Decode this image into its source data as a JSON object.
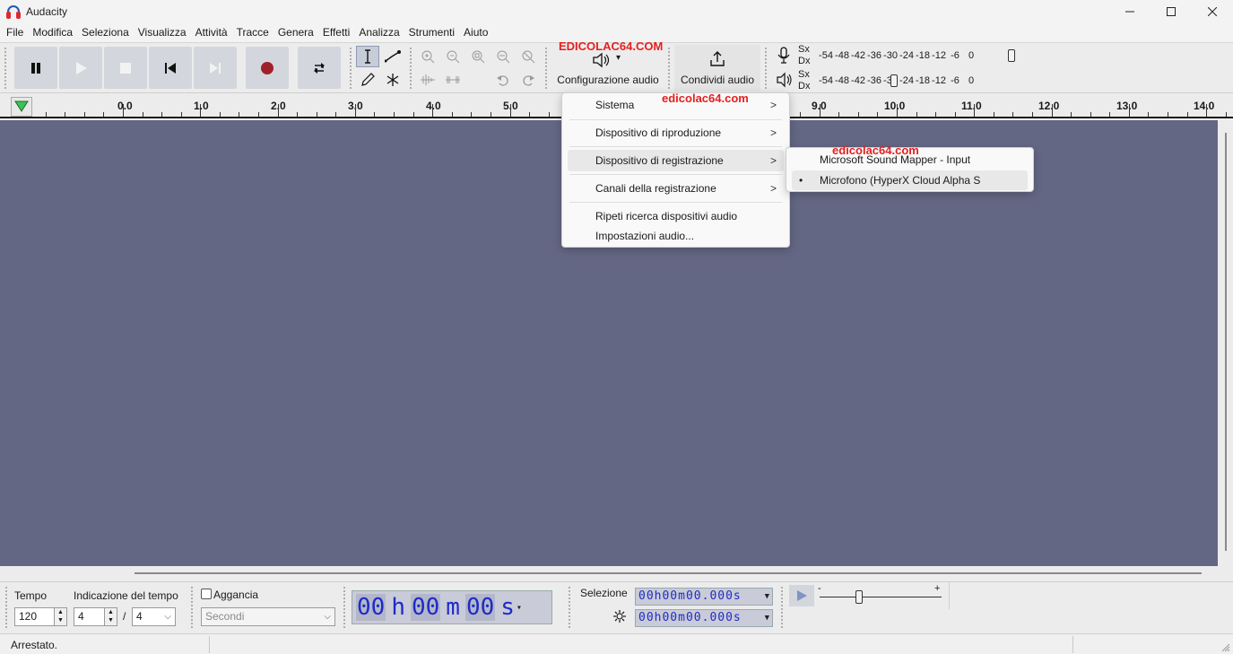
{
  "window": {
    "title": "Audacity",
    "minimize": "—",
    "maximize": "☐",
    "close": "✕"
  },
  "menubar": [
    "File",
    "Modifica",
    "Seleziona",
    "Visualizza",
    "Attività",
    "Tracce",
    "Genera",
    "Effetti",
    "Analizza",
    "Strumenti",
    "Aiuto"
  ],
  "toolbar": {
    "audio_setup_label": "Configurazione audio",
    "audio_setup_arrow": "▾",
    "share_audio_label": "Condividi audio",
    "watermark_top": "EDICOLAC64.COM",
    "meters": {
      "record_channels": [
        "Sx",
        "Dx"
      ],
      "play_channels": [
        "Sx",
        "Dx"
      ],
      "record_scale": [
        "-54",
        "-48",
        "-42",
        "-36",
        "-30",
        "-24",
        "-18",
        "-12",
        "-6",
        "0"
      ],
      "play_scale": [
        "-54",
        "-48",
        "-42",
        "-36",
        "-30",
        "-24",
        "-18",
        "-12",
        "-6",
        "0"
      ]
    }
  },
  "timeline": {
    "ticks": [
      "0.0",
      "1.0",
      "2.0",
      "3.0",
      "4.0",
      "5.0",
      "9.0",
      "10.0",
      "11.0",
      "12.0",
      "13.0",
      "14.0"
    ]
  },
  "audio_menu": {
    "watermark": "edicolac64.com",
    "items": [
      {
        "label": "Sistema",
        "submenu": true
      },
      {
        "label": "Dispositivo di riproduzione",
        "submenu": true
      },
      {
        "label": "Dispositivo di registrazione",
        "submenu": true
      },
      {
        "label": "Canali della registrazione",
        "submenu": true
      },
      {
        "label": "Ripeti ricerca dispositivi audio",
        "submenu": false
      },
      {
        "label": "Impostazioni audio...",
        "submenu": false
      }
    ],
    "chevron": ">"
  },
  "recording_device_menu": {
    "watermark": "edicolac64.com",
    "items": [
      {
        "label": "Microsoft Sound Mapper - Input",
        "selected": false
      },
      {
        "label": "Microfono (HyperX Cloud Alpha S",
        "selected": true
      }
    ],
    "bullet": "•"
  },
  "bottom": {
    "tempo_label": "Tempo",
    "tempo_value": "120",
    "time_sig_label": "Indicazione del tempo",
    "time_sig_num": "4",
    "time_sig_slash": "/",
    "time_sig_den": "4",
    "snap_label": "Aggancia",
    "snap_unit": "Secondi",
    "time_display": {
      "h": "00",
      "h_unit": "h",
      "m": "00",
      "m_unit": "m",
      "s": "00",
      "s_unit": "s"
    },
    "selection_label": "Selezione",
    "selection_start": "00h00m00.000s",
    "selection_end": "00h00m00.000s",
    "speed_minus": "-",
    "speed_plus": "+"
  },
  "statusbar": {
    "status": "Arrestato."
  }
}
